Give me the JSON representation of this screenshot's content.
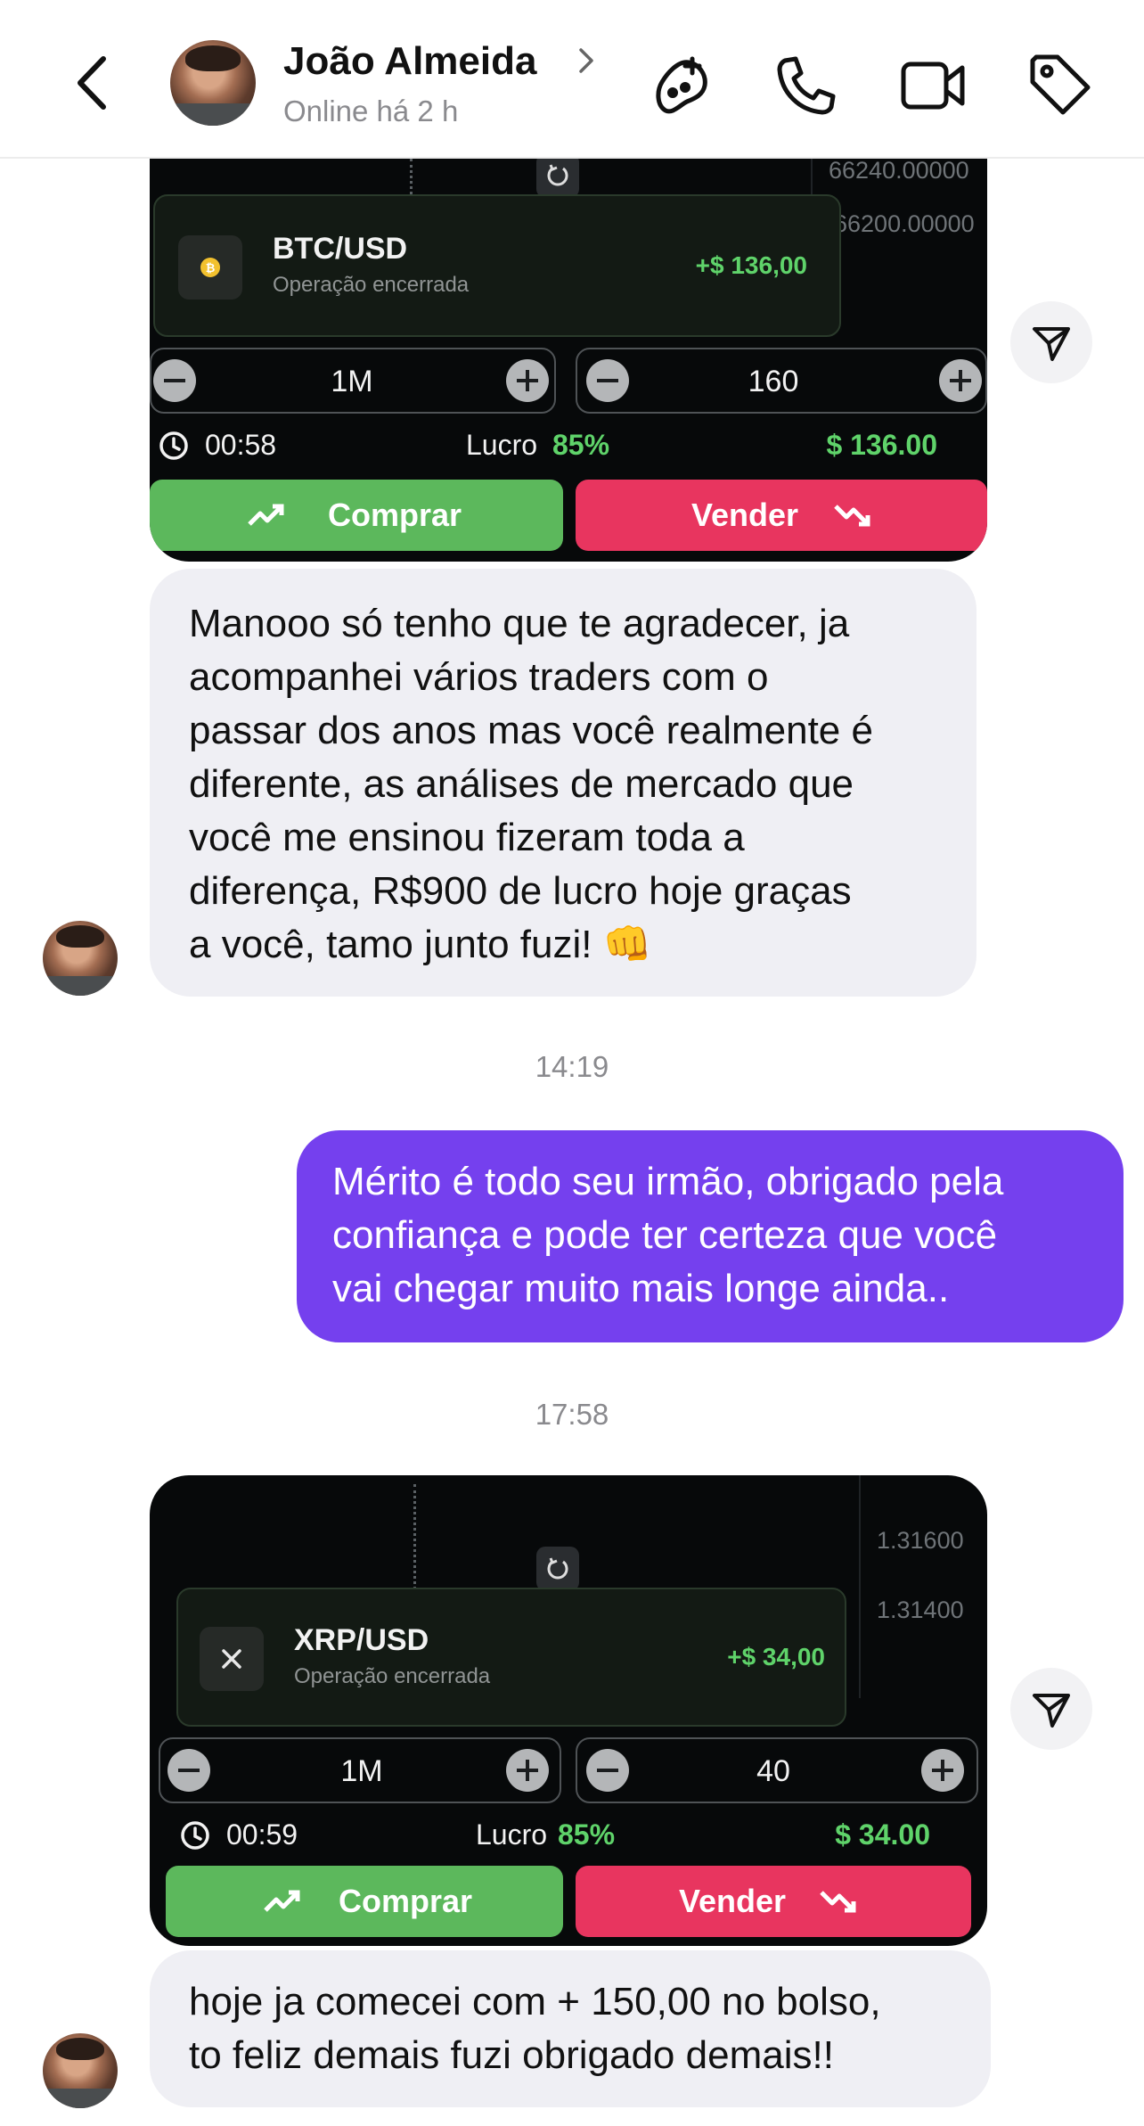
{
  "header": {
    "contact_name": "João Almeida",
    "status": "Online há 2 h"
  },
  "messages": [
    {
      "type": "trade_screenshot",
      "pair": "BTC/USD",
      "status": "Operação encerrada",
      "profit": "+$ 136,00",
      "price_ticks": [
        "66240.00000",
        "66200.00000"
      ],
      "time_value": "1M",
      "amount_value": "160",
      "timer": "00:58",
      "lucro_label": "Lucro",
      "lucro_pct": "85%",
      "payout": "$ 136.00",
      "buy_label": "Comprar",
      "sell_label": "Vender"
    },
    {
      "type": "text",
      "from": "contact",
      "lines": [
        "Manooo só tenho que te agradecer, ja",
        "acompanhei vários traders com o",
        "passar dos anos mas você realmente é",
        "diferente, as análises de mercado que",
        "você me ensinou fizeram toda a",
        "diferença, R$900 de lucro hoje graças",
        "a você, tamo junto fuzi! 👊"
      ]
    },
    {
      "type": "timestamp",
      "text": "14:19"
    },
    {
      "type": "text",
      "from": "me",
      "lines": [
        "Mérito é todo seu irmão, obrigado pela",
        "confiança e pode ter certeza que você",
        "vai chegar muito mais longe ainda.."
      ]
    },
    {
      "type": "timestamp",
      "text": "17:58"
    },
    {
      "type": "trade_screenshot",
      "pair": "XRP/USD",
      "status": "Operação encerrada",
      "profit": "+$ 34,00",
      "price_ticks": [
        "1.31600",
        "1.31400"
      ],
      "time_value": "1M",
      "amount_value": "40",
      "timer": "00:59",
      "lucro_label": "Lucro",
      "lucro_pct": "85%",
      "payout": "$ 34.00",
      "buy_label": "Comprar",
      "sell_label": "Vender"
    },
    {
      "type": "text",
      "from": "contact",
      "lines": [
        "hoje ja comecei com + 150,00 no bolso,",
        "to feliz demais fuzi obrigado demais!!"
      ]
    }
  ],
  "colors": {
    "outgoing_bubble": "#7540ee",
    "incoming_bubble": "#efeff4",
    "profit_green": "#5fd36a",
    "buy_green": "#5cb85c",
    "sell_red": "#e8355f"
  }
}
